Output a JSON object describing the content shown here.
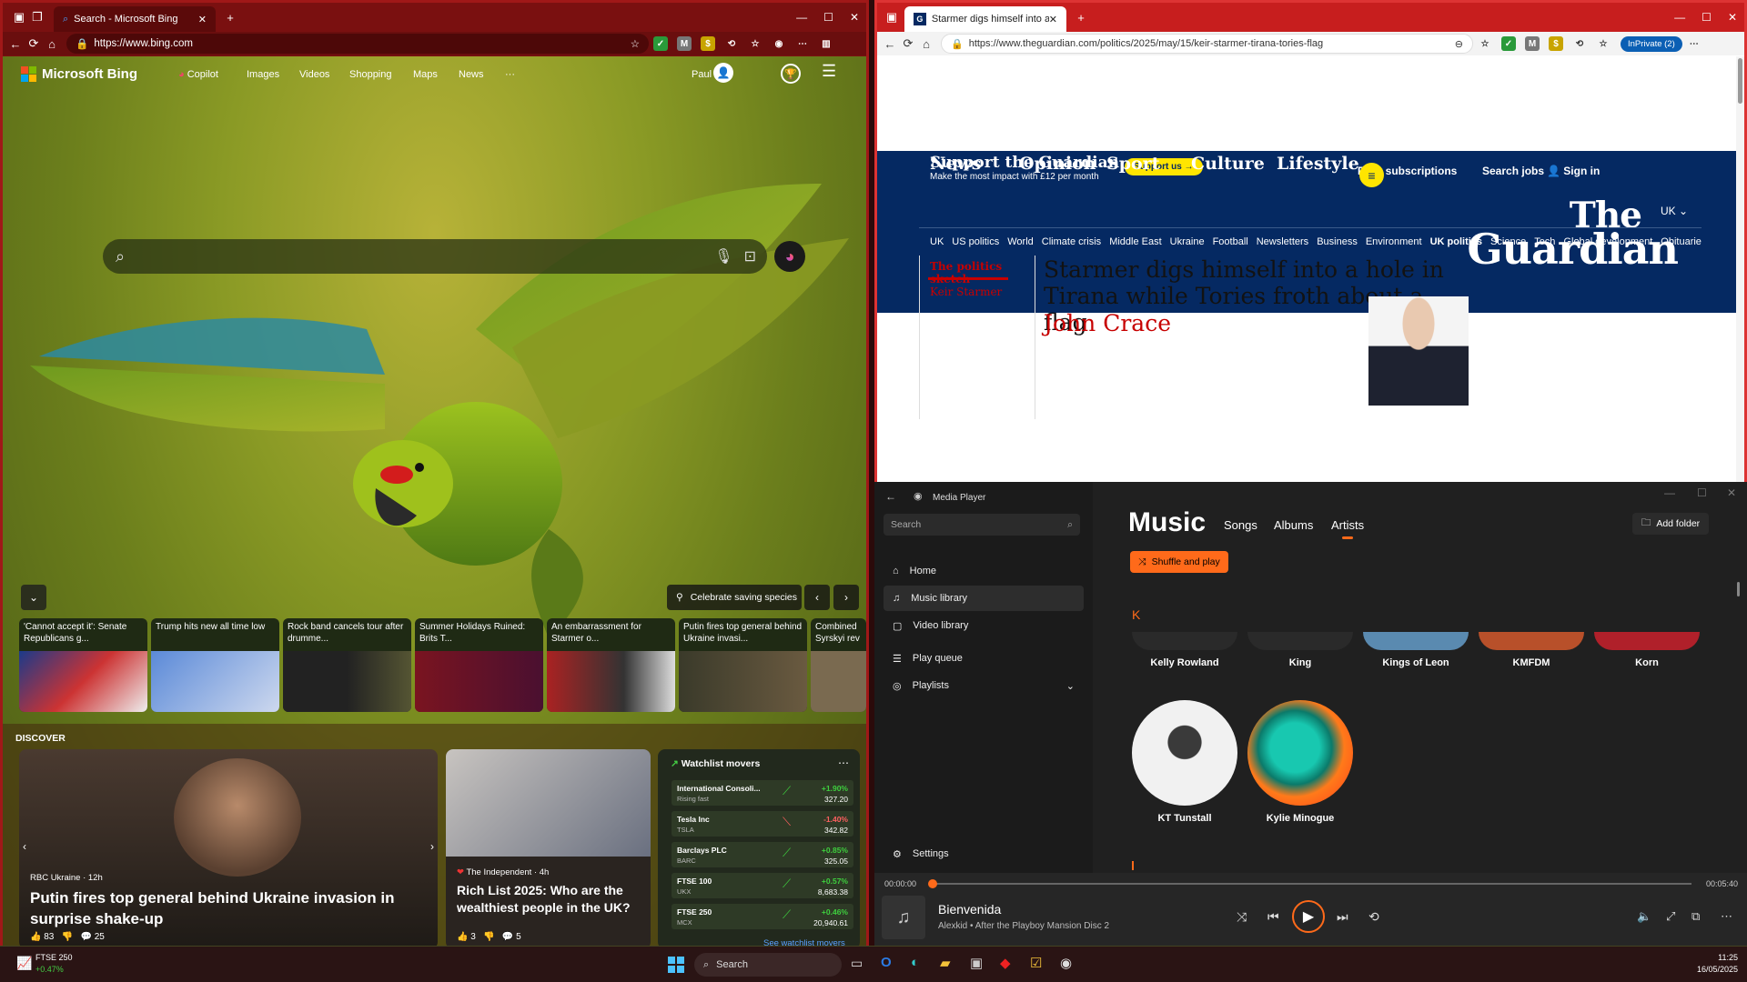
{
  "bing": {
    "tab_title": "Search - Microsoft Bing",
    "url": "https://www.bing.com",
    "brand": "Microsoft Bing",
    "nav": [
      "Copilot",
      "Images",
      "Videos",
      "Shopping",
      "Maps",
      "News",
      "···"
    ],
    "user": "Paul",
    "celebrate": "Celebrate saving species",
    "news": [
      "'Cannot accept it': Senate Republicans g...",
      "Trump hits new all time low",
      "Rock band cancels tour after drumme...",
      "Summer Holidays Ruined: Brits T...",
      "An embarrassment for Starmer o...",
      "Putin fires top general behind Ukraine invasi...",
      "Combined Syrskyi rev"
    ],
    "discover": "DISCOVER",
    "main_story": {
      "source": "RBC Ukraine · 12h",
      "title": "Putin fires top general behind Ukraine invasion in surprise shake-up",
      "likes": "83",
      "comments": "25"
    },
    "side_story": {
      "source": "The Independent · 4h",
      "title": "Rich List 2025: Who are the wealthiest people in the UK?",
      "likes": "3",
      "comments": "5"
    },
    "watchlist": {
      "title": "Watchlist movers",
      "see_more": "See watchlist movers",
      "items": [
        {
          "name": "International Consoli...",
          "sub": "Rising fast",
          "chg": "+1.90%",
          "price": "327.20",
          "up": true
        },
        {
          "name": "Tesla Inc",
          "sub": "TSLA",
          "chg": "-1.40%",
          "price": "342.82",
          "up": false
        },
        {
          "name": "Barclays PLC",
          "sub": "BARC",
          "chg": "+0.85%",
          "price": "325.05",
          "up": true
        },
        {
          "name": "FTSE 100",
          "sub": "UKX",
          "chg": "+0.57%",
          "price": "8,683.38",
          "up": true
        },
        {
          "name": "FTSE 250",
          "sub": "MCX",
          "chg": "+0.46%",
          "price": "20,940.61",
          "up": true
        }
      ]
    }
  },
  "guardian": {
    "tab_title": "Starmer digs himself into a hole in...",
    "url": "https://www.theguardian.com/politics/2025/may/15/keir-starmer-tirana-tories-flag",
    "inprivate": "InPrivate (2)",
    "support_title": "Support the Guardian",
    "support_sub": "Make the most impact with £12 per month",
    "support_btn": "Support us →",
    "print_sub": "Print subscriptions",
    "search_jobs": "Search jobs",
    "sign_in": "Sign in",
    "edition": "UK",
    "logo_line1": "The",
    "logo_line2": "Guardian",
    "pillars": [
      "News",
      "Opinion",
      "Sport",
      "Culture",
      "Lifestyle"
    ],
    "subnav": [
      "UK",
      "US politics",
      "World",
      "Climate crisis",
      "Middle East",
      "Ukraine",
      "Football",
      "Newsletters",
      "Business",
      "Environment",
      "UK politics",
      "Science",
      "Tech",
      "Global development",
      "Obituaries"
    ],
    "kicker1": "The politics sketch",
    "kicker2": "Keir Starmer",
    "headline": "Starmer digs himself into a hole in Tirana while Tories froth about a flag",
    "byline": "John Crace"
  },
  "media": {
    "app": "Media Player",
    "search": "Search",
    "nav": [
      "Home",
      "Music library",
      "Video library",
      "Play queue",
      "Playlists",
      "Settings"
    ],
    "title": "Music",
    "tabs": [
      "Songs",
      "Albums",
      "Artists"
    ],
    "add_folder": "Add folder",
    "shuffle": "Shuffle and play",
    "letter": "K",
    "artists_row1": [
      "Kelly Rowland",
      "King",
      "Kings of Leon",
      "KMFDM",
      "Korn"
    ],
    "artists_row2": [
      "KT Tunstall",
      "Kylie Minogue"
    ],
    "time_start": "00:00:00",
    "time_end": "00:05:40",
    "progress": 0,
    "track": "Bienvenida",
    "track_sub": "Alexkid • After the Playboy Mansion Disc 2"
  },
  "taskbar": {
    "ticker": "FTSE 250",
    "ticker_chg": "+0.47%",
    "search": "Search",
    "time": "11:25",
    "date": "16/05/2025"
  }
}
